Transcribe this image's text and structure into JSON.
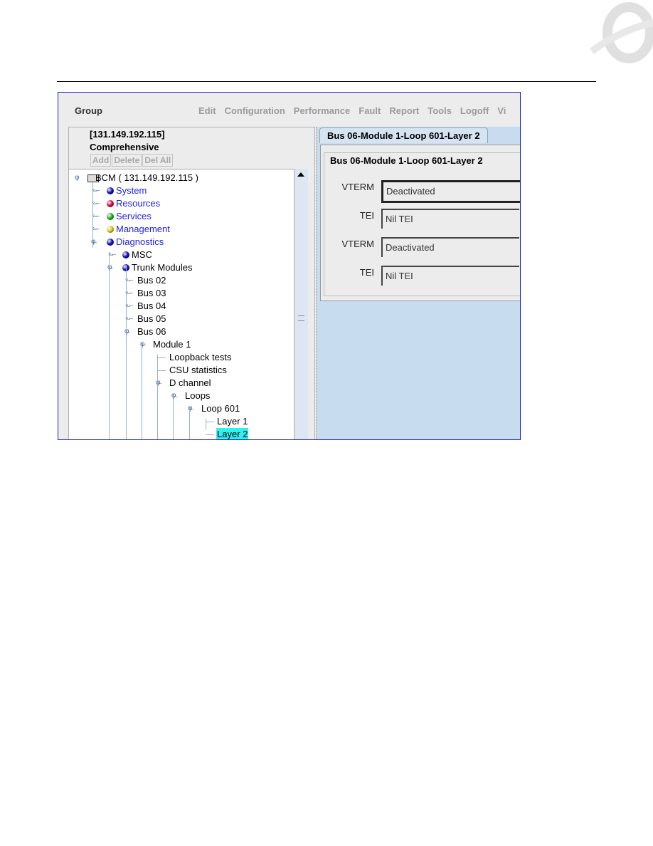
{
  "app": {
    "group_label": "Group",
    "menus": [
      "Edit",
      "Configuration",
      "Performance",
      "Fault",
      "Report",
      "Tools",
      "Logoff",
      "Vi"
    ],
    "left": {
      "address": "[131.149.192.115]",
      "mode": "Comprehensive",
      "buttons": [
        "Add",
        "Delete",
        "Del All"
      ]
    },
    "tree": [
      {
        "label": "BCM ( 131.149.192.115 )",
        "level": 0,
        "icon": "server-icon",
        "expanded": true
      },
      {
        "label": "System",
        "level": 1,
        "dot": "#1010c0",
        "link": true
      },
      {
        "label": "Resources",
        "level": 1,
        "dot": "#d01040",
        "link": true
      },
      {
        "label": "Services",
        "level": 1,
        "dot": "#20b020",
        "link": true
      },
      {
        "label": "Management",
        "level": 1,
        "dot": "#d8d010",
        "link": true
      },
      {
        "label": "Diagnostics",
        "level": 1,
        "dot": "#1010c0",
        "link": true,
        "expanded": true
      },
      {
        "label": "MSC",
        "level": 2,
        "dot": "#1010c0"
      },
      {
        "label": "Trunk Modules",
        "level": 2,
        "dot": "#1010c0",
        "expanded": true
      },
      {
        "label": "Bus 02",
        "level": 3
      },
      {
        "label": "Bus 03",
        "level": 3
      },
      {
        "label": "Bus 04",
        "level": 3
      },
      {
        "label": "Bus 05",
        "level": 3
      },
      {
        "label": "Bus 06",
        "level": 3,
        "expanded": true
      },
      {
        "label": "Module 1",
        "level": 4,
        "expanded": true
      },
      {
        "label": "Loopback tests",
        "level": 5,
        "leaf": true
      },
      {
        "label": "CSU statistics",
        "level": 5,
        "leaf": true
      },
      {
        "label": "D channel",
        "level": 5,
        "expanded": true
      },
      {
        "label": "Loops",
        "level": 6,
        "expanded": true
      },
      {
        "label": "Loop 601",
        "level": 7,
        "expanded": true
      },
      {
        "label": "Layer 1",
        "level": 8,
        "leaf": true
      },
      {
        "label": "Layer 2",
        "level": 8,
        "leaf": true,
        "selected": true
      }
    ],
    "right": {
      "tab": "Bus 06-Module 1-Loop 601-Layer 2",
      "legend": "Bus 06-Module 1-Loop 601-Layer 2",
      "fields": [
        {
          "label": "VTERM",
          "value": "Deactivated",
          "focused": true
        },
        {
          "label": "TEI",
          "value": "Nil TEI"
        },
        {
          "label": "VTERM",
          "value": "Deactivated"
        },
        {
          "label": "TEI",
          "value": "Nil TEI"
        }
      ]
    }
  }
}
